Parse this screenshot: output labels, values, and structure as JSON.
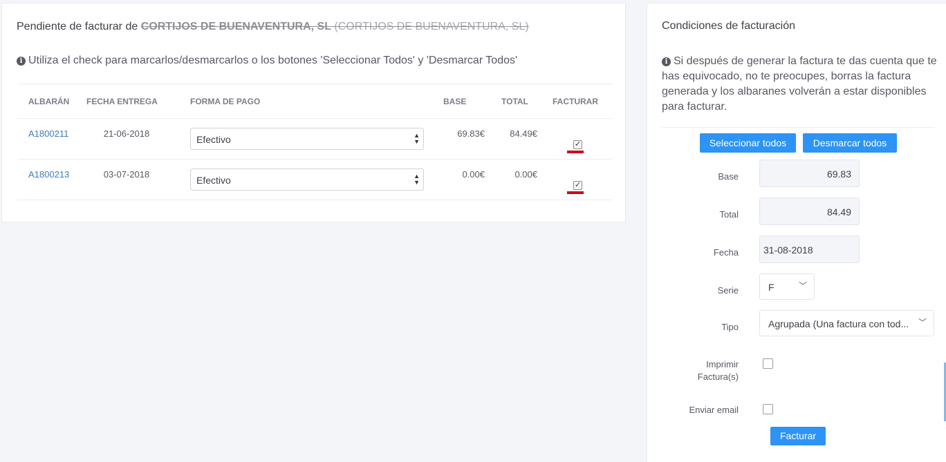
{
  "left": {
    "title_prefix": "Pendiente de facturar de",
    "customer_bold": "CORTIJOS DE BUENAVENTURA, SL",
    "customer_paren": "(CORTIJOS DE BUENAVENTURA, SL)",
    "info": "Utiliza el check para marcarlos/desmarcarlos o los botones 'Seleccionar Todos' y 'Desmarcar Todos'",
    "columns": {
      "albaran": "ALBARÁN",
      "fecha": "FECHA ENTREGA",
      "forma": "FORMA DE PAGO",
      "base": "BASE",
      "total": "TOTAL",
      "facturar": "FACTURAR"
    },
    "rows": [
      {
        "albaran": "A1800211",
        "fecha": "21-06-2018",
        "forma": "Efectivo",
        "base": "69.83€",
        "total": "84.49€",
        "facturar": true
      },
      {
        "albaran": "A1800213",
        "fecha": "03-07-2018",
        "forma": "Efectivo",
        "base": "0.00€",
        "total": "0.00€",
        "facturar": true
      }
    ]
  },
  "right": {
    "title": "Condiciones de facturación",
    "info": "Si después de generar la factura te das cuenta que te has equivocado, no te preocupes, borras la factura generada y los albaranes volverán a estar disponibles para facturar.",
    "select_all": "Seleccionar todos",
    "deselect_all": "Desmarcar todos",
    "base_label": "Base",
    "base_value": "69.83",
    "total_label": "Total",
    "total_value": "84.49",
    "fecha_label": "Fecha",
    "fecha_value": "31-08-2018",
    "serie_label": "Serie",
    "serie_value": "F",
    "tipo_label": "Tipo",
    "tipo_value": "Agrupada (Una factura con tod...",
    "imprimir_label_1": "Imprimir",
    "imprimir_label_2": "Factura(s)",
    "imprimir_checked": false,
    "email_label": "Enviar email",
    "email_checked": false,
    "submit": "Facturar"
  },
  "colors": {
    "accent": "#2d93f5",
    "link": "#3b7bbf",
    "marker": "#d0021b"
  },
  "icons": {
    "info": "info-circle-icon",
    "check": "check-icon",
    "chevron": "chevron-down-icon",
    "select_arrows": "select-arrows-icon"
  }
}
